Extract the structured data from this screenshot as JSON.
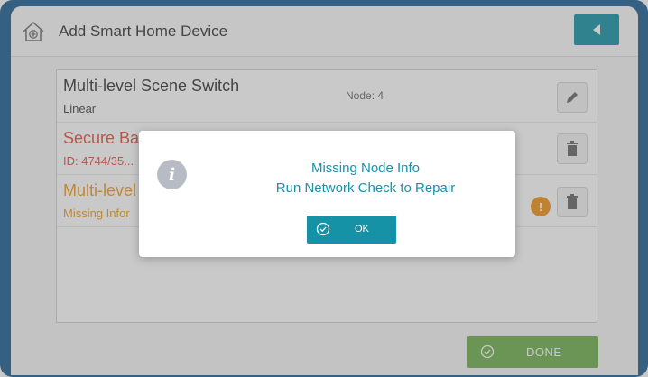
{
  "header": {
    "title": "Add Smart Home Device",
    "home_icon": "home-plus-icon",
    "back_icon": "back-arrow-icon"
  },
  "devices": [
    {
      "name": "Multi-level Scene Switch",
      "subtitle": "Linear",
      "node": "Node: 4",
      "action_icon": "pencil-icon",
      "color": "#333333"
    },
    {
      "name": "Secure Bar... Add...",
      "subtitle": "ID: 4744/35...",
      "action_icon": "trash-icon",
      "color": "#e0523d"
    },
    {
      "name": "Multi-level",
      "subtitle": "Missing Infor",
      "warning_icon": "warning-icon",
      "action_icon": "trash-icon",
      "color": "#f09a1e"
    }
  ],
  "done_button": {
    "label": "DONE",
    "icon": "check-circle-icon",
    "color": "#6db04d"
  },
  "dialog": {
    "title": "Missing Node Info",
    "message": "Run Network Check to Repair",
    "info_icon": "info-icon",
    "ok_label": "OK",
    "ok_icon": "check-circle-icon",
    "accent": "#1592a6"
  }
}
